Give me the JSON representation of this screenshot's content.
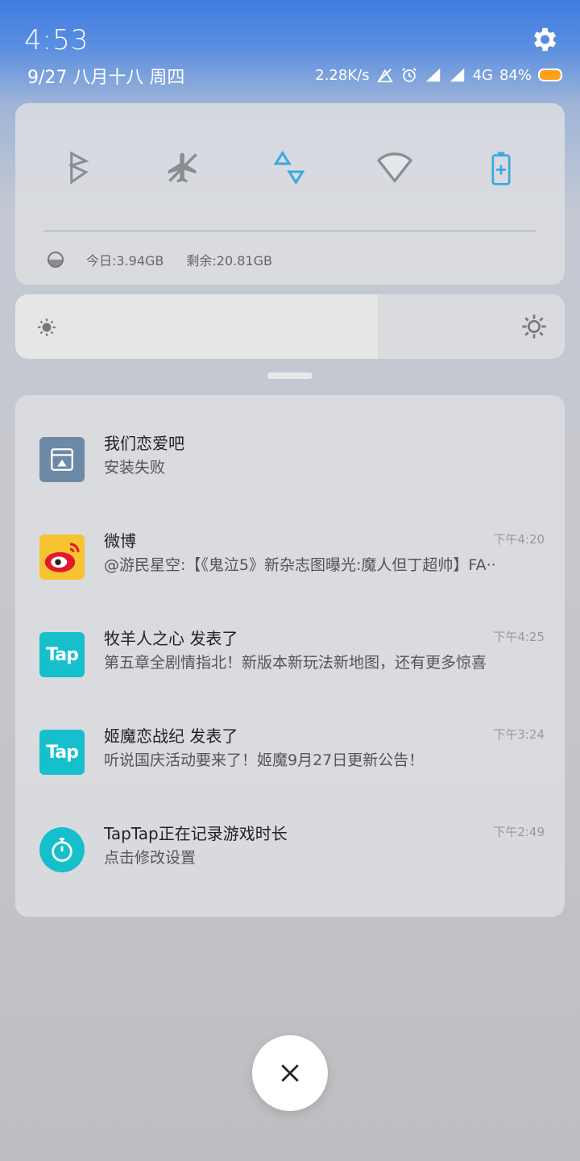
{
  "status": {
    "time": "4:53",
    "date": "9/27  八月十八  周四",
    "net_speed": "2.28K/s",
    "network_type": "4G",
    "battery": "84%",
    "battery_level": 0.84,
    "battery_color": "#ff9f1c",
    "icons": [
      "settings-icon",
      "no-sim-icon",
      "alarm-icon",
      "signal-icon",
      "signal-icon",
      "battery-icon"
    ]
  },
  "quick_settings": {
    "toggles": [
      "bluetooth-icon",
      "airplane-off-icon",
      "data-transfer-icon",
      "wifi-icon",
      "battery-saver-icon"
    ],
    "usage_today": "今日:3.94GB",
    "usage_remaining": "剩余:20.81GB"
  },
  "brightness": {
    "level": 0.66
  },
  "notifications": [
    {
      "app_icon": "app-installer-icon",
      "title": "我们恋爱吧",
      "body": "安装失败",
      "time": ""
    },
    {
      "app_icon": "weibo-icon",
      "title": "微博",
      "body": "@游民星空:【《鬼泣5》新杂志图曝光:魔人但丁超帅】FA··",
      "time": "下午4:20"
    },
    {
      "app_icon": "taptap-icon",
      "title": "牧羊人之心 发表了",
      "body": "第五章全剧情指北！新版本新玩法新地图，还有更多惊喜",
      "time": "下午4:25"
    },
    {
      "app_icon": "taptap-icon",
      "title": "姬魔恋战纪 发表了",
      "body": "听说国庆活动要来了！姬魔9月27日更新公告！",
      "time": "下午3:24"
    },
    {
      "app_icon": "stopwatch-icon",
      "title": "TapTap正在记录游戏时长",
      "body": "点击修改设置",
      "time": "下午2:49"
    }
  ],
  "tap_logo_text": "Tap",
  "colors": {
    "tap_teal": "#16bfcc",
    "toggle_active": "#3aa9e0",
    "weibo_red": "#e6162d",
    "weibo_yellow": "#f7c431"
  }
}
